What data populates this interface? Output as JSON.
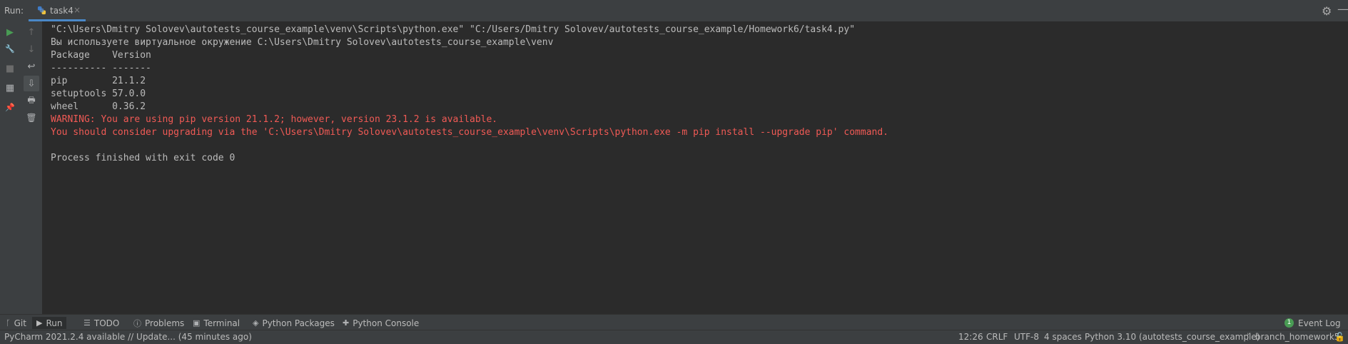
{
  "run_header": {
    "label": "Run:",
    "tab_title": "task4",
    "close_glyph": "×",
    "settings_glyph": "⚙",
    "hide_glyph": "—"
  },
  "left_toolbar": {
    "primary": [
      {
        "name": "rerun-icon",
        "glyph": "▶"
      },
      {
        "name": "modify-run-config-icon",
        "glyph": "🔧"
      },
      {
        "name": "stop-icon",
        "glyph": "■"
      },
      {
        "name": "layout-icon",
        "glyph": "▦"
      },
      {
        "name": "pin-tab-icon",
        "glyph": "📌"
      }
    ],
    "secondary": [
      {
        "name": "up-stack-icon",
        "glyph": "↑"
      },
      {
        "name": "down-stack-icon",
        "glyph": "↓"
      },
      {
        "name": "soft-wrap-icon",
        "glyph": "↩"
      },
      {
        "name": "scroll-to-end-icon",
        "glyph": "⇩"
      },
      {
        "name": "print-icon",
        "glyph": "🖶"
      },
      {
        "name": "clear-all-icon",
        "glyph": "🗑"
      }
    ]
  },
  "console": {
    "lines": [
      {
        "text": "\"C:\\Users\\Dmitry Solovev\\autotests_course_example\\venv\\Scripts\\python.exe\" \"C:/Users/Dmitry Solovev/autotests_course_example/Homework6/task4.py\"",
        "type": "normal"
      },
      {
        "text": "Вы используете виртуальное окружение C:\\Users\\Dmitry Solovev\\autotests_course_example\\venv",
        "type": "normal"
      },
      {
        "text": "Package    Version",
        "type": "normal"
      },
      {
        "text": "---------- -------",
        "type": "normal"
      },
      {
        "text": "pip        21.1.2",
        "type": "normal"
      },
      {
        "text": "setuptools 57.0.0",
        "type": "normal"
      },
      {
        "text": "wheel      0.36.2",
        "type": "normal"
      },
      {
        "text": "WARNING: You are using pip version 21.1.2; however, version 23.1.2 is available.",
        "type": "error"
      },
      {
        "text": "You should consider upgrading via the 'C:\\Users\\Dmitry Solovev\\autotests_course_example\\venv\\Scripts\\python.exe -m pip install --upgrade pip' command.",
        "type": "error"
      },
      {
        "text": "",
        "type": "normal"
      },
      {
        "text": "Process finished with exit code 0",
        "type": "normal"
      }
    ]
  },
  "tool_windows": {
    "git": "Git",
    "run": "Run",
    "todo": "TODO",
    "problems": "Problems",
    "terminal": "Terminal",
    "python_packages": "Python Packages",
    "python_console": "Python Console",
    "event_log": "Event Log",
    "event_count": "1"
  },
  "status_bar": {
    "message": "PyCharm 2021.2.4 available // Update... (45 minutes ago)",
    "position": "12:26",
    "line_separator": "CRLF",
    "encoding": "UTF-8",
    "indent": "4 spaces",
    "interpreter": "Python 3.10 (autotests_course_example)",
    "branch": "branch_homework5"
  },
  "colors": {
    "accent": "#4a88c7",
    "error_text": "#f05a55",
    "run_green": "#499c54",
    "background": "#2b2b2b",
    "panel": "#3c3f41"
  }
}
